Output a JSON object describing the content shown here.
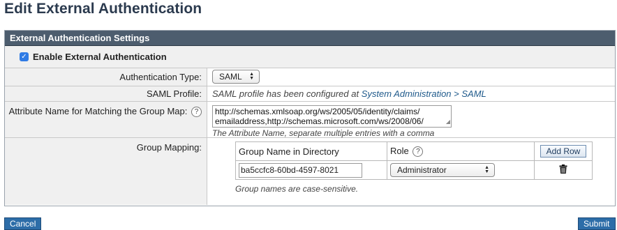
{
  "page_title": "Edit External Authentication",
  "panel": {
    "header": "External Authentication Settings",
    "enable_label": "Enable External Authentication",
    "enable_checked": true
  },
  "fields": {
    "auth_type_label": "Authentication Type:",
    "auth_type_value": "SAML",
    "saml_profile_label": "SAML Profile:",
    "saml_profile_text": "SAML profile has been configured at",
    "saml_profile_link": "System Administration > SAML",
    "attr_label": "Attribute Name for Matching the Group Map:",
    "attr_value_line1": "http://schemas.xmlsoap.org/ws/2005/05/identity/claims/",
    "attr_value_line2": "emailaddress,http://schemas.microsoft.com/ws/2008/06/",
    "attr_hint": "The Attribute Name, separate multiple entries with a comma",
    "group_mapping_label": "Group Mapping:"
  },
  "group_table": {
    "col_group": "Group Name in Directory",
    "col_role": "Role",
    "add_row": "Add Row",
    "rows": [
      {
        "group": "ba5ccfc8-60bd-4597-8021",
        "role": "Administrator"
      }
    ],
    "note": "Group names are case-sensitive."
  },
  "icons": {
    "help": "?",
    "checkmark": "✓",
    "trash": "trash-icon"
  },
  "buttons": {
    "cancel": "Cancel",
    "submit": "Submit"
  },
  "colors": {
    "title": "#2b3a4e",
    "header_bg": "#4d5d6e",
    "button_bg": "#2d6da8",
    "link": "#1f5a8b",
    "checkbox": "#2f7be5"
  }
}
